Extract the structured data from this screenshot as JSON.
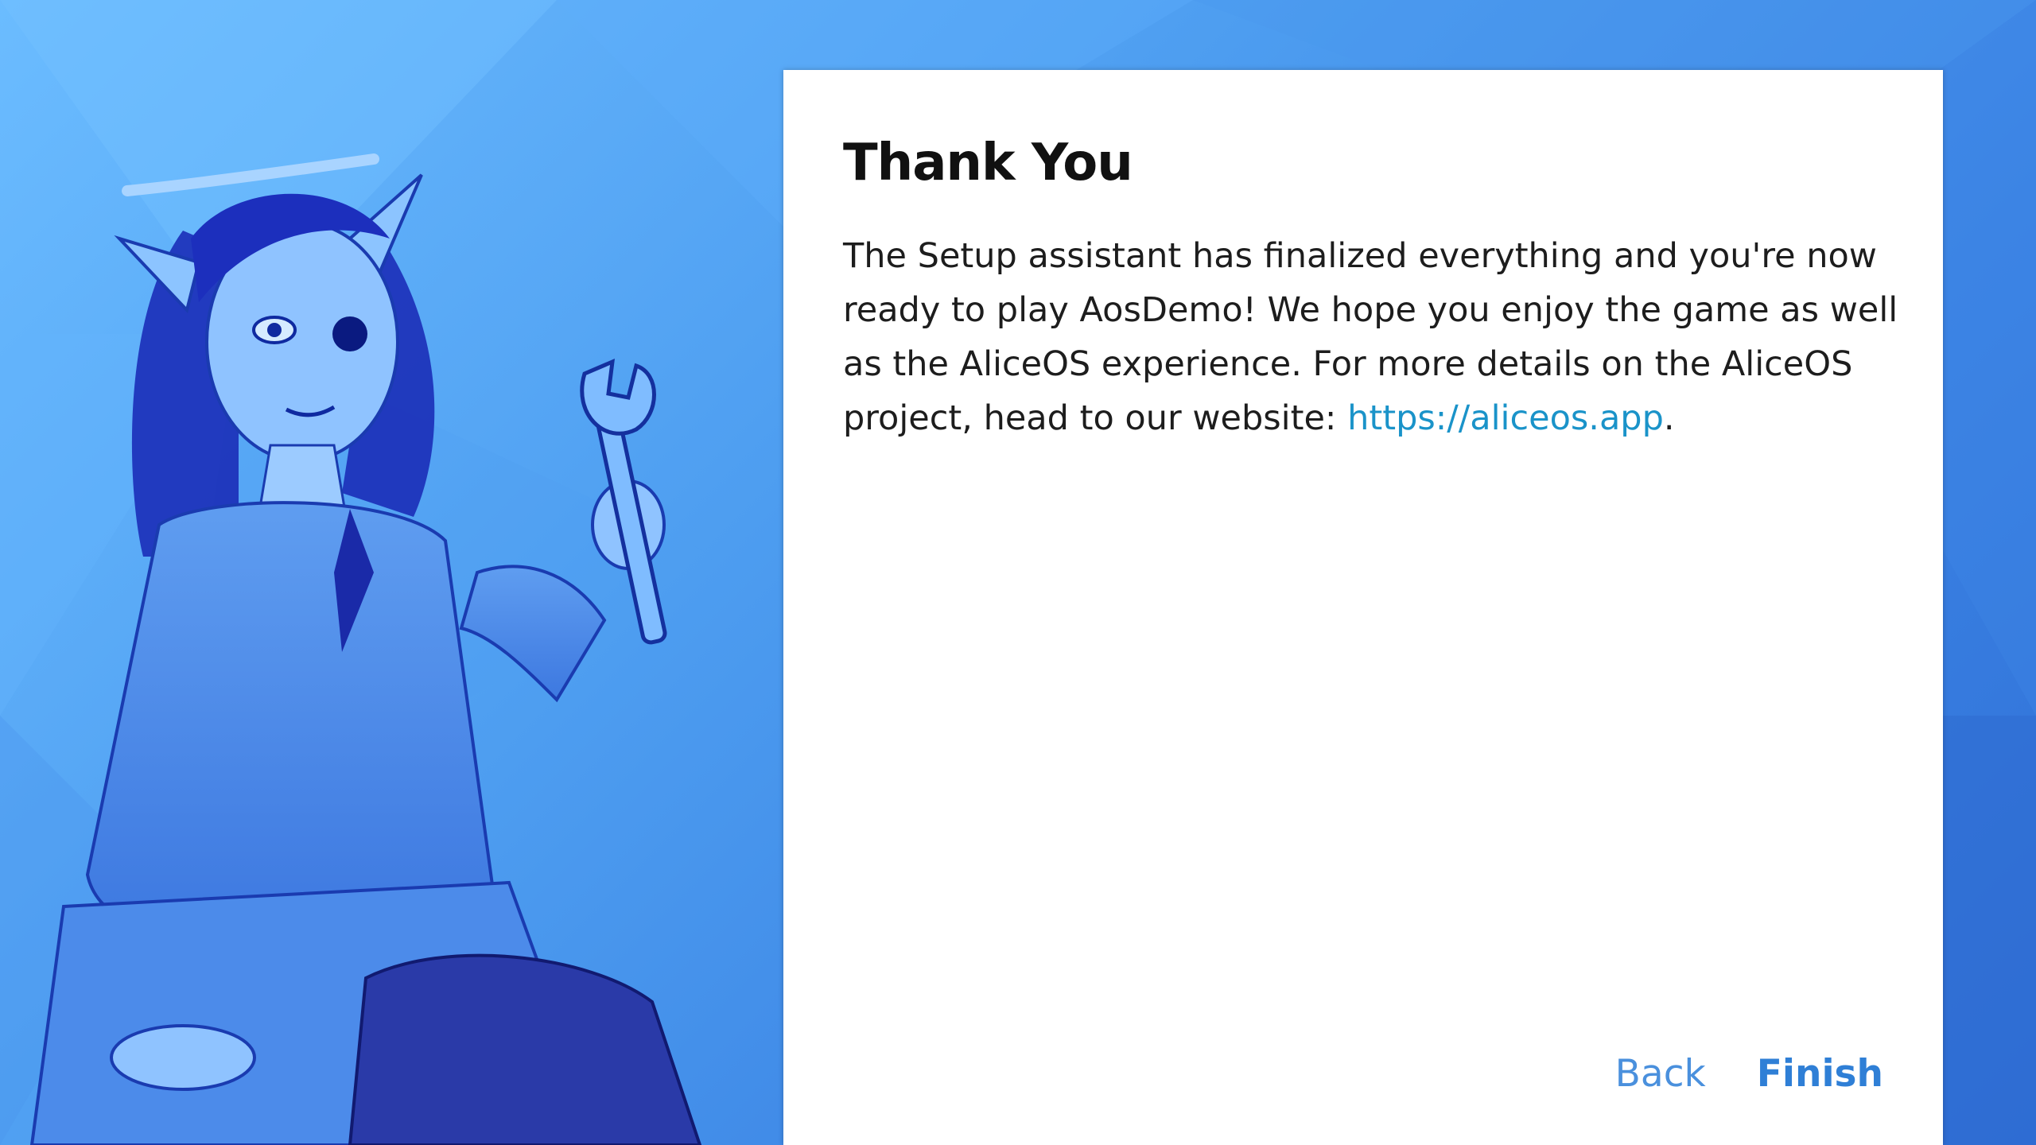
{
  "dialog": {
    "title": "Thank You",
    "body_lines": {
      "part1": "The Setup assistant has finalized everything and you're now ready to play AosDemo! We hope you enjoy the game as well as the AliceOS experience. For more details on the AliceOS project, head to our website: ",
      "link": "https://aliceos.app",
      "part2": "."
    }
  },
  "actions": {
    "back_label": "Back",
    "finish_label": "Finish"
  },
  "colors": {
    "background_accent": "#4d9df0",
    "link": "#1a93c9",
    "button": "#2f7fd6"
  },
  "illustration": {
    "description_icon": "character-with-wrench-illustration"
  }
}
